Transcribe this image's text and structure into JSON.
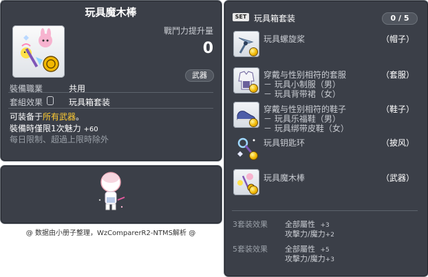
{
  "item_id": "01703133",
  "item": {
    "name": "玩具魔木棒",
    "power_label": "戰鬥力提升量",
    "power_value": "0",
    "category_badge": "武器",
    "job_label": "裝備職業",
    "job_value": "共用",
    "set_label": "套組效果",
    "set_value": "玩具箱套装",
    "equip_prefix": "可装备于",
    "equip_highlight": "所有武器",
    "equip_suffix": "。",
    "limit_text": "裝備時僅限1次魅力",
    "limit_bonus": "+60",
    "daily_text": "每日限制、超過上限時除外"
  },
  "footer_text": "@ 数据由小册子整理，WzComparerR2-NTMS解析 @",
  "set_panel": {
    "badge": "SET",
    "title": "玩具箱套装",
    "count": "0 / 5",
    "items": [
      {
        "name": "玩具螺旋桨",
        "slot": "（帽子）",
        "subs": []
      },
      {
        "name": "穿戴与性别相符的套服",
        "slot": "（套服）",
        "subs": [
          "－ 玩具小制服（男）",
          "－ 玩具背带裙（女）"
        ]
      },
      {
        "name": "穿戴与性别相符的鞋子",
        "slot": "（鞋子）",
        "subs": [
          "－ 玩具乐福鞋（男）",
          "－ 玩具绑带皮鞋（女）"
        ]
      },
      {
        "name": "玩具钥匙环",
        "slot": "（披风）",
        "subs": []
      },
      {
        "name": "玩具魔木棒",
        "slot": "（武器）",
        "subs": []
      }
    ],
    "effects": [
      {
        "label": "3套装效果",
        "lines": [
          {
            "stat": "全部屬性",
            "val": "+3"
          },
          {
            "stat": "攻擊力/魔力",
            "val": "+2"
          }
        ]
      },
      {
        "label": "5套装效果",
        "lines": [
          {
            "stat": "全部屬性",
            "val": "+5"
          },
          {
            "stat": "攻擊力/魔力",
            "val": "+3"
          }
        ]
      }
    ]
  },
  "colors": {
    "panel": "#3b3f48",
    "highlight": "#ffcc33"
  }
}
